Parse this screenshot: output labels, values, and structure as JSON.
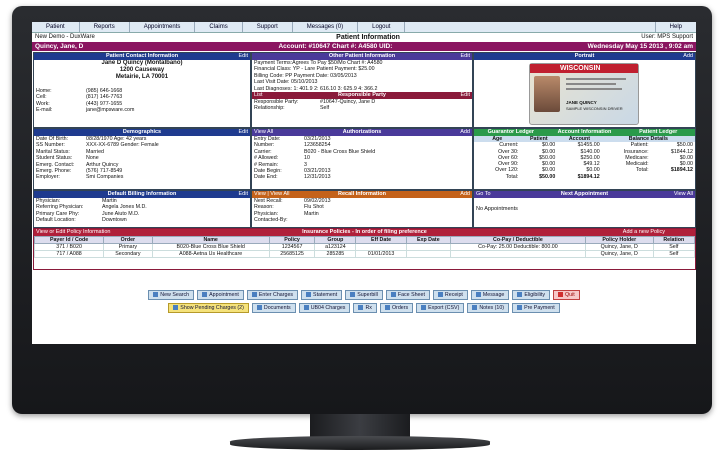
{
  "menu": [
    "Patient",
    "Reports",
    "Appointments",
    "Claims",
    "Support",
    "Messages (0)",
    "Logout"
  ],
  "menu_help": "Help",
  "top": {
    "left": "New Demo - DuxWare",
    "title": "Patient Information",
    "right": "User: MPS Support"
  },
  "patient_bar": {
    "name": "Quincy, Jane, D",
    "account": "Account: #10647  Chart #: A4580  UID:",
    "date": "Wednesday May 15 2013 , 9:02 am"
  },
  "contact": {
    "header": "Patient Contact Information",
    "edit": "Edit",
    "name": "Jane D Quincy  (Montalbano)",
    "addr1": "1200 Causeway",
    "addr2": "Metairie, LA  70001",
    "rows": [
      [
        "Home:",
        "(985) 646-1668"
      ],
      [
        "Cell:",
        "(817) 146-7763"
      ],
      [
        "Work:",
        "(443) 977-1655"
      ],
      [
        "E-mail:",
        "jane@mpsware.com"
      ]
    ]
  },
  "other": {
    "header": "Other Patient Information",
    "edit": "Edit",
    "rows": [
      "Payment Terms:Agrees To Pay $50/Mo  Chart #: A4580",
      "Financial Class:  YP - Lare  Patient Payment: $25.00",
      "Billing Code:     PP        Payment Date:   03/05/2013",
      "Last Visit Date:  05/10/2013",
      "Last Diagnoses:  1: 401.9   2: 616.10   3: 625.9   4: 366.2"
    ],
    "sub": "List",
    "sub_header": "Responsible Party",
    "sub_edit": "Edit",
    "sub_rows": [
      [
        "Responsible Party:",
        "#10647-Quincy, Jane D"
      ],
      [
        "Relationship:",
        "Self"
      ]
    ]
  },
  "portrait": {
    "header": "Portrait",
    "add": "Add",
    "state": "WISCONSIN",
    "card_name": "JANE QUINCY",
    "card_sub": "SAMPLE WISCONSIN DRIVER"
  },
  "demographics": {
    "header": "Demographics",
    "edit": "Edit",
    "rows": [
      [
        "Date Of Birth:",
        "08/28/1970   Age: 42 years"
      ],
      [
        "SS Number:",
        "XXX-XX-6789   Gender: Female"
      ],
      [
        "Marital Status:",
        "Married"
      ],
      [
        "Student Status:",
        "None"
      ],
      [
        "Emerg. Contact:",
        "Arthur Quincy"
      ],
      [
        "Emerg. Phone:",
        "(576) 717-8549"
      ],
      [
        "Employer:",
        "Smi Companies"
      ]
    ]
  },
  "auth": {
    "left": "View All",
    "header": "Authorizations",
    "add": "Add",
    "rows": [
      [
        "Entry Date:",
        "03/21/2013"
      ],
      [
        "Number:",
        "123658254"
      ],
      [
        "Carrier:",
        "B020 - Blue Cross Blue Shield"
      ],
      [
        "# Allowed:",
        "10"
      ],
      [
        "# Remain:",
        "3"
      ],
      [
        "Date Begin:",
        "03/21/2013"
      ],
      [
        "Date End:",
        "12/31/2013"
      ]
    ]
  },
  "ledger": {
    "h1": "Guarantor Ledger",
    "h2": "Account Information",
    "h3": "Patient Ledger",
    "cols": [
      "Age",
      "Patient",
      "Account"
    ],
    "bal": "Balance Details",
    "rows": [
      [
        "Current:",
        "$0.00",
        "$1455.00",
        "Patient:",
        "$50.00"
      ],
      [
        "Over 30:",
        "$0.00",
        "$140.00",
        "Insurance:",
        "$1844.12"
      ],
      [
        "Over 60:",
        "$50.00",
        "$250.00",
        "Medicare:",
        "$0.00"
      ],
      [
        "Over 90:",
        "$0.00",
        "$49.12",
        "Medicaid:",
        "$0.00"
      ],
      [
        "Over 120:",
        "$0.00",
        "$0.00",
        "Total:",
        "$1894.12"
      ],
      [
        "Total:",
        "$50.00",
        "$1894.12",
        "",
        ""
      ]
    ]
  },
  "billing": {
    "header": "Default Billing Information",
    "edit": "Edit",
    "rows": [
      [
        "Physician:",
        "Martin"
      ],
      [
        "Referring Physician:",
        "Angela Jones M.D."
      ],
      [
        "Primary Care Phy:",
        "June Aiuto M.D."
      ],
      [
        "Default Location:",
        "Downtown"
      ]
    ]
  },
  "recall": {
    "left": "View | View All",
    "header": "Recall Information",
    "add": "Add",
    "rows": [
      [
        "Next Recall:",
        "09/02/2013"
      ],
      [
        "Reason:",
        "Flu Shot"
      ],
      [
        "Physician:",
        "Martin"
      ],
      [
        "Contacted-By:",
        ""
      ]
    ]
  },
  "appt": {
    "left": "Go To",
    "header": "Next Appointment",
    "right": "View All",
    "body": "No Appointments"
  },
  "policy": {
    "left": "View or Edit Policy Information",
    "header": "Insurance Policies - In order of filing preference",
    "right": "Add a new Policy",
    "cols": [
      "Payer Id / Code",
      "Order",
      "Name",
      "Policy",
      "Group",
      "Eff Date",
      "Exp Date",
      "Co-Pay / Deductible",
      "Policy Holder",
      "Relation"
    ],
    "rows": [
      [
        "371 / B020",
        "Primary",
        "B020-Blue Cross Blue Shield",
        "1234567",
        "a123124",
        "",
        "",
        "Co-Pay: 25.00 Deductible: 800.00",
        "Quincy, Jane, D",
        "Self"
      ],
      [
        "717 / A088",
        "Secondary",
        "A088-Aetna Us Healthcare",
        "25685125",
        "285285",
        "01/01/2013",
        "",
        "",
        "Quincy, Jane, D",
        "Self"
      ]
    ]
  },
  "buttons1": [
    "New Search",
    "Appointment",
    "Enter Charges",
    "Statement",
    "Superbill",
    "Face Sheet",
    "Receipt",
    "Message",
    "Eligibility",
    "Quit"
  ],
  "buttons2": [
    "Show Pending Charges (2)",
    "Documents",
    "UB04 Charges",
    "Rx",
    "Orders",
    "Export (CSV)",
    "Notes (10)",
    "Pre Payment"
  ]
}
